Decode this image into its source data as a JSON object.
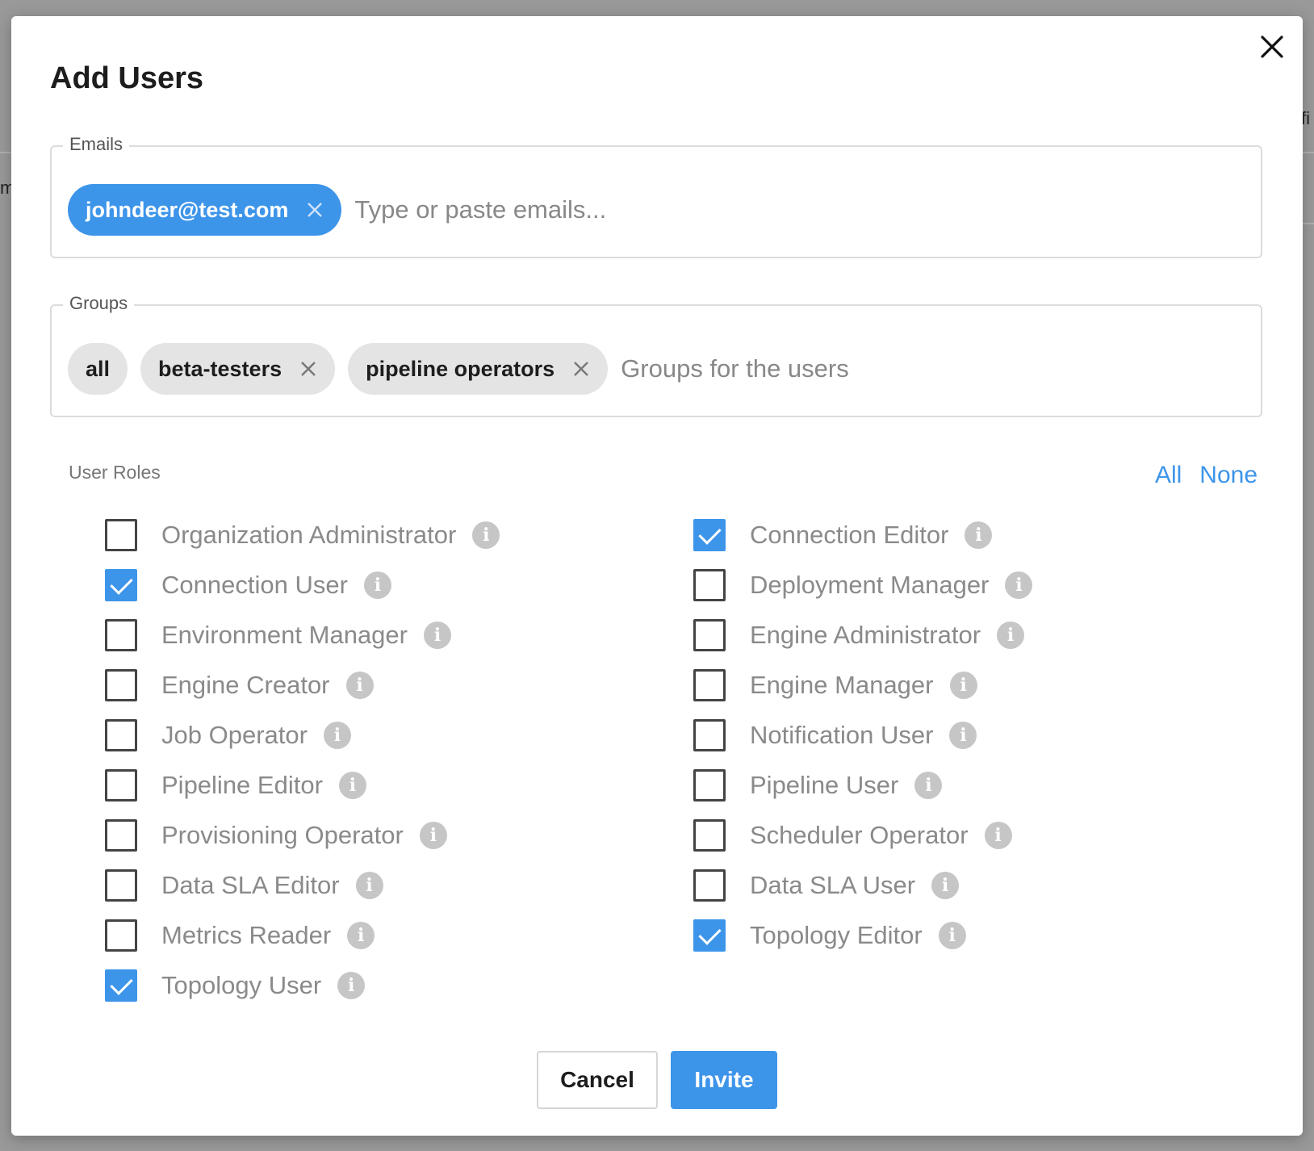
{
  "background": {
    "fragment_left": "m",
    "fragment_right": "fi"
  },
  "modal": {
    "title": "Add Users",
    "close_icon": "close-icon"
  },
  "emails": {
    "legend": "Emails",
    "chips": [
      {
        "label": "johndeer@test.com",
        "removable": true
      }
    ],
    "placeholder": "Type or paste emails..."
  },
  "groups": {
    "legend": "Groups",
    "chips": [
      {
        "label": "all",
        "removable": false
      },
      {
        "label": "beta-testers",
        "removable": true
      },
      {
        "label": "pipeline operators",
        "removable": true
      }
    ],
    "placeholder": "Groups for the users"
  },
  "roles": {
    "label": "User Roles",
    "select_all": "All",
    "select_none": "None",
    "left": [
      {
        "label": "Organization Administrator",
        "checked": false
      },
      {
        "label": "Connection User",
        "checked": true
      },
      {
        "label": "Environment Manager",
        "checked": false
      },
      {
        "label": "Engine Creator",
        "checked": false
      },
      {
        "label": "Job Operator",
        "checked": false
      },
      {
        "label": "Pipeline Editor",
        "checked": false
      },
      {
        "label": "Provisioning Operator",
        "checked": false
      },
      {
        "label": "Data SLA Editor",
        "checked": false
      },
      {
        "label": "Metrics Reader",
        "checked": false
      },
      {
        "label": "Topology User",
        "checked": true
      }
    ],
    "right": [
      {
        "label": "Connection Editor",
        "checked": true
      },
      {
        "label": "Deployment Manager",
        "checked": false
      },
      {
        "label": "Engine Administrator",
        "checked": false
      },
      {
        "label": "Engine Manager",
        "checked": false
      },
      {
        "label": "Notification User",
        "checked": false
      },
      {
        "label": "Pipeline User",
        "checked": false
      },
      {
        "label": "Scheduler Operator",
        "checked": false
      },
      {
        "label": "Data SLA User",
        "checked": false
      },
      {
        "label": "Topology Editor",
        "checked": true
      }
    ],
    "info_glyph": "i"
  },
  "footer": {
    "cancel": "Cancel",
    "invite": "Invite"
  },
  "colors": {
    "accent": "#3d95ea",
    "chip_grey": "#e4e4e4",
    "overlay": "#999999"
  }
}
